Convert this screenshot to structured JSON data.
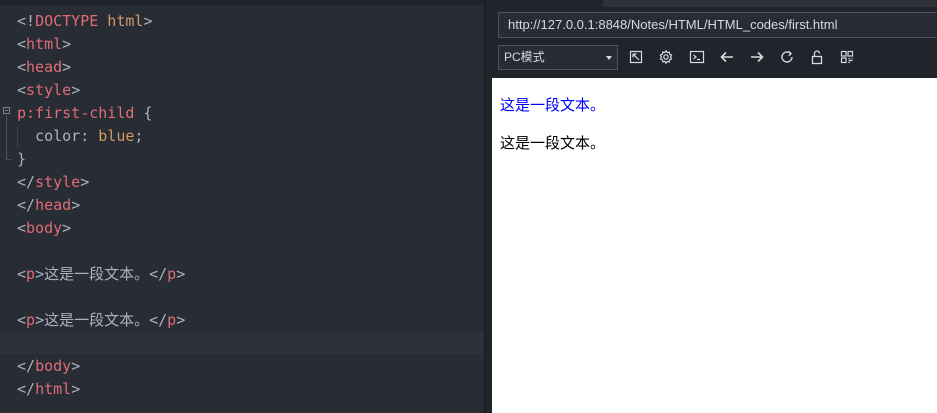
{
  "editor": {
    "lines": [
      {
        "parts": [
          {
            "t": "<!",
            "c": "punc"
          },
          {
            "t": "DOCTYPE",
            "c": "tag"
          },
          {
            "t": " html",
            "c": "val"
          },
          {
            "t": ">",
            "c": "punc"
          }
        ]
      },
      {
        "parts": [
          {
            "t": "<",
            "c": "punc"
          },
          {
            "t": "html",
            "c": "tag"
          },
          {
            "t": ">",
            "c": "punc"
          }
        ]
      },
      {
        "parts": [
          {
            "t": "<",
            "c": "punc"
          },
          {
            "t": "head",
            "c": "tag"
          },
          {
            "t": ">",
            "c": "punc"
          }
        ]
      },
      {
        "parts": [
          {
            "t": "<",
            "c": "punc"
          },
          {
            "t": "style",
            "c": "tag"
          },
          {
            "t": ">",
            "c": "punc"
          }
        ]
      },
      {
        "parts": [
          {
            "t": "p:first-child",
            "c": "sel"
          },
          {
            "t": " {",
            "c": "punc"
          }
        ]
      },
      {
        "parts": [
          {
            "t": "  color",
            "c": "prop"
          },
          {
            "t": ": ",
            "c": "punc"
          },
          {
            "t": "blue",
            "c": "val"
          },
          {
            "t": ";",
            "c": "punc"
          }
        ]
      },
      {
        "parts": [
          {
            "t": "}",
            "c": "punc"
          }
        ]
      },
      {
        "parts": [
          {
            "t": "</",
            "c": "punc"
          },
          {
            "t": "style",
            "c": "tag"
          },
          {
            "t": ">",
            "c": "punc"
          }
        ]
      },
      {
        "parts": [
          {
            "t": "</",
            "c": "punc"
          },
          {
            "t": "head",
            "c": "tag"
          },
          {
            "t": ">",
            "c": "punc"
          }
        ]
      },
      {
        "parts": [
          {
            "t": "<",
            "c": "punc"
          },
          {
            "t": "body",
            "c": "tag"
          },
          {
            "t": ">",
            "c": "punc"
          }
        ]
      },
      {
        "parts": []
      },
      {
        "parts": [
          {
            "t": "<",
            "c": "punc"
          },
          {
            "t": "p",
            "c": "tag"
          },
          {
            "t": ">",
            "c": "punc"
          },
          {
            "t": "这是一段文本。",
            "c": "txt"
          },
          {
            "t": "</",
            "c": "punc"
          },
          {
            "t": "p",
            "c": "tag"
          },
          {
            "t": ">",
            "c": "punc"
          }
        ]
      },
      {
        "parts": []
      },
      {
        "parts": [
          {
            "t": "<",
            "c": "punc"
          },
          {
            "t": "p",
            "c": "tag"
          },
          {
            "t": ">",
            "c": "punc"
          },
          {
            "t": "这是一段文本。",
            "c": "txt"
          },
          {
            "t": "</",
            "c": "punc"
          },
          {
            "t": "p",
            "c": "tag"
          },
          {
            "t": ">",
            "c": "punc"
          }
        ]
      },
      {
        "parts": []
      },
      {
        "parts": [
          {
            "t": "</",
            "c": "punc"
          },
          {
            "t": "body",
            "c": "tag"
          },
          {
            "t": ">",
            "c": "punc"
          }
        ]
      },
      {
        "parts": [
          {
            "t": "</",
            "c": "punc"
          },
          {
            "t": "html",
            "c": "tag"
          },
          {
            "t": ">",
            "c": "punc"
          }
        ]
      }
    ]
  },
  "browser": {
    "url": "http://127.0.0.1:8848/Notes/HTML/HTML_codes/first.html",
    "mode": "PC模式",
    "toolbar_icons": [
      "open-external-icon",
      "settings-icon",
      "console-icon",
      "back-arrow-icon",
      "forward-arrow-icon",
      "refresh-icon",
      "unlock-icon",
      "qrcode-icon"
    ],
    "paragraphs": [
      {
        "text": "这是一段文本。",
        "color": "#0000ff"
      },
      {
        "text": "这是一段文本。",
        "color": "#000000"
      }
    ]
  },
  "colors": {
    "editor_bg": "#282c34",
    "tag": "#e06c75",
    "value": "#d19a66",
    "plain": "#abb2bf"
  }
}
